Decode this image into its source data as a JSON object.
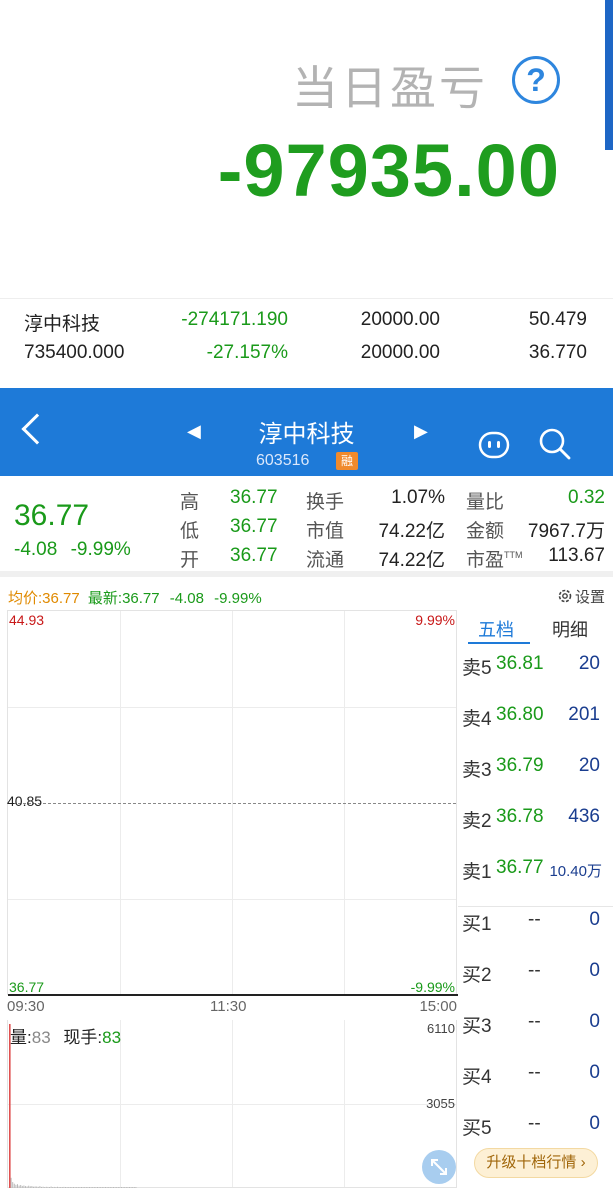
{
  "pnl": {
    "title": "当日盈亏",
    "value": "-97935.00"
  },
  "holding": {
    "row1": [
      "淳中科技",
      "-274171.190",
      "20000.00",
      "50.479"
    ],
    "row2": [
      "735400.000",
      "-27.157%",
      "20000.00",
      "36.770"
    ]
  },
  "stock": {
    "name": "淳中科技",
    "code": "603516",
    "badge": "融"
  },
  "quote": {
    "price": "36.77",
    "change": "-4.08",
    "change_pct": "-9.99%",
    "cells": {
      "high_label": "高",
      "high": "36.77",
      "low_label": "低",
      "low": "36.77",
      "open_label": "开",
      "open": "36.77",
      "turnover_label": "换手",
      "turnover": "1.07%",
      "mktcap_label": "市值",
      "mktcap": "74.22亿",
      "float_label": "流通",
      "float": "74.22亿",
      "volratio_label": "量比",
      "volratio": "0.32",
      "amount_label": "金额",
      "amount": "7967.7万",
      "pe_label": "市盈",
      "pe_sup": "TTM",
      "pe": "113.67"
    }
  },
  "chart_legend": {
    "avg_label": "均价:",
    "avg": "36.77",
    "last_label": "最新:",
    "last": "36.77",
    "change": "-4.08",
    "change_pct": "-9.99%",
    "settings_label": "设置"
  },
  "chart_data": {
    "type": "line",
    "y_labels": {
      "top": "44.93",
      "mid": "40.85",
      "bottom": "36.77",
      "top_pct": "9.99%",
      "bottom_pct": "-9.99%"
    },
    "ylim": [
      36.77,
      44.93
    ],
    "x_ticks": [
      "09:30",
      "11:30",
      "15:00"
    ],
    "series": [
      {
        "values": [
          36.77,
          36.77
        ]
      }
    ],
    "volume": {
      "label": "量:",
      "value": "83",
      "current_label": "现手:",
      "current": "83",
      "ticks": [
        "6110",
        "3055"
      ],
      "ylim": [
        0,
        6110
      ],
      "bars": [
        6110,
        380,
        220,
        160,
        120,
        140,
        90,
        110,
        80,
        95,
        70,
        60,
        85,
        65,
        75,
        50,
        60,
        55,
        45,
        70,
        40,
        50,
        35,
        45,
        40,
        30,
        55,
        35,
        40,
        30,
        45,
        25,
        35,
        30,
        40,
        25,
        30,
        20,
        35,
        28,
        22,
        30,
        25,
        20,
        28,
        18,
        25,
        22,
        20,
        18,
        24,
        16,
        20,
        18,
        15,
        22,
        14,
        18,
        16,
        20,
        12,
        15,
        18,
        14,
        12,
        16,
        10,
        14,
        12,
        10,
        15,
        9,
        12,
        10,
        8,
        14,
        9,
        11,
        10,
        8
      ]
    }
  },
  "book": {
    "tab_five": "五档",
    "tab_detail": "明细",
    "asks": [
      {
        "label": "卖5",
        "price": "36.81",
        "vol": "20"
      },
      {
        "label": "卖4",
        "price": "36.80",
        "vol": "201"
      },
      {
        "label": "卖3",
        "price": "36.79",
        "vol": "20"
      },
      {
        "label": "卖2",
        "price": "36.78",
        "vol": "436"
      },
      {
        "label": "卖1",
        "price": "36.77",
        "vol": "10.40万"
      }
    ],
    "bids": [
      {
        "label": "买1",
        "price": "--",
        "vol": "0"
      },
      {
        "label": "买2",
        "price": "--",
        "vol": "0"
      },
      {
        "label": "买3",
        "price": "--",
        "vol": "0"
      },
      {
        "label": "买4",
        "price": "--",
        "vol": "0"
      },
      {
        "label": "买5",
        "price": "--",
        "vol": "0"
      }
    ],
    "upgrade_label": "升级十档行情"
  },
  "colors": {
    "accent": "#1e7ad8",
    "down": "#1a9a1a",
    "up": "#c81818",
    "volume_bar": "#e07070"
  }
}
